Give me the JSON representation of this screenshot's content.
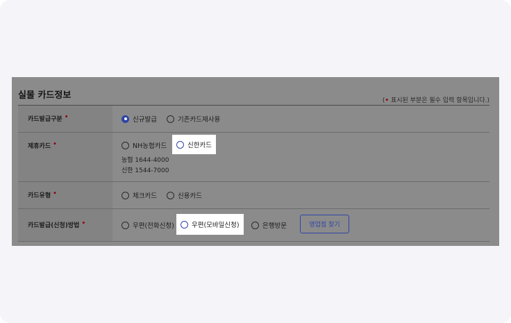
{
  "section": {
    "title": "실물 카드정보",
    "required_note_prefix": "(",
    "required_note_dot": "•",
    "required_note_text": " 표시된 부분은 필수 입력 항목입니다.)"
  },
  "required_mark": "•",
  "rows": {
    "issue_type": {
      "label": "카드발급구분",
      "options": [
        {
          "label": "신규발급",
          "selected": true
        },
        {
          "label": "기존카드재사용",
          "selected": false
        }
      ]
    },
    "partner_card": {
      "label": "제휴카드",
      "options": [
        {
          "label": "NH농협카드",
          "selected": false
        },
        {
          "label": "신한카드",
          "selected": true
        }
      ],
      "phones": [
        "농협 1644-4000",
        "신한 1544-7000"
      ]
    },
    "card_type": {
      "label": "카드유형",
      "options": [
        {
          "label": "체크카드",
          "selected": false
        },
        {
          "label": "신용카드",
          "selected": false
        }
      ]
    },
    "issue_method": {
      "label": "카드발급(신청)방법",
      "options": [
        {
          "label": "우편(전화신청)",
          "selected": false
        },
        {
          "label": "우편(모바일신청)",
          "selected": true
        },
        {
          "label": "은행방문",
          "selected": false
        }
      ],
      "branch_button": "영업점 찾기"
    }
  },
  "colors": {
    "accent": "#2e44a6",
    "required_dot": "#8c0a1e",
    "overlay": "#8b8b8b"
  }
}
